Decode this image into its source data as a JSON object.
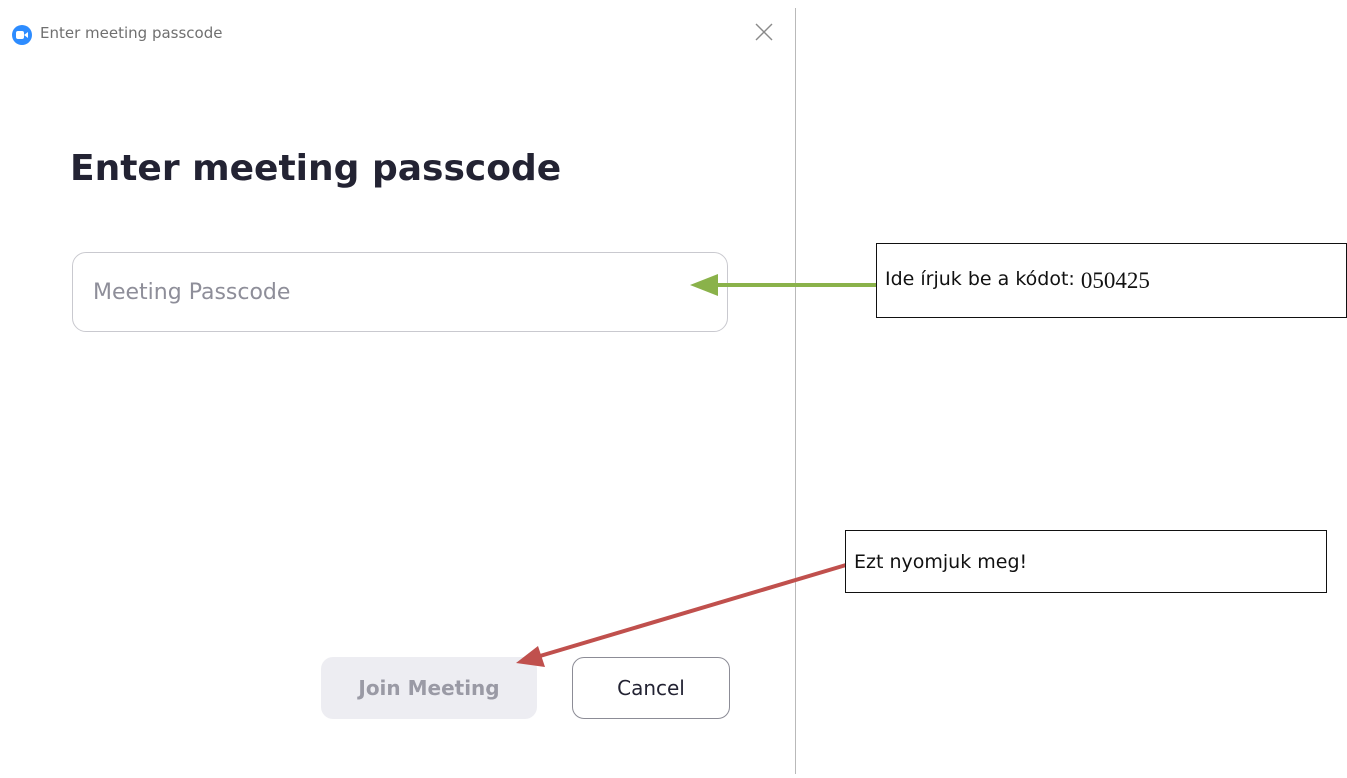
{
  "window": {
    "title": "Enter meeting passcode",
    "app_icon": "zoom-camera-icon",
    "close_icon": "close-icon"
  },
  "dialog": {
    "heading": "Enter meeting passcode",
    "passcode_input": {
      "placeholder": "Meeting Passcode",
      "value": ""
    },
    "join_button": "Join Meeting",
    "cancel_button": "Cancel"
  },
  "annotations": {
    "passcode_note": {
      "text": "Ide írjuk be a kódot:",
      "code": "050425",
      "arrow_color": "#8ab24a"
    },
    "join_note": {
      "text": "Ezt nyomjuk meg!",
      "arrow_color": "#c0504d"
    }
  },
  "colors": {
    "accent": "#2d8cff",
    "heading": "#232333",
    "disabled_button_bg": "#ededf2",
    "disabled_button_text": "#9a9aa5"
  }
}
